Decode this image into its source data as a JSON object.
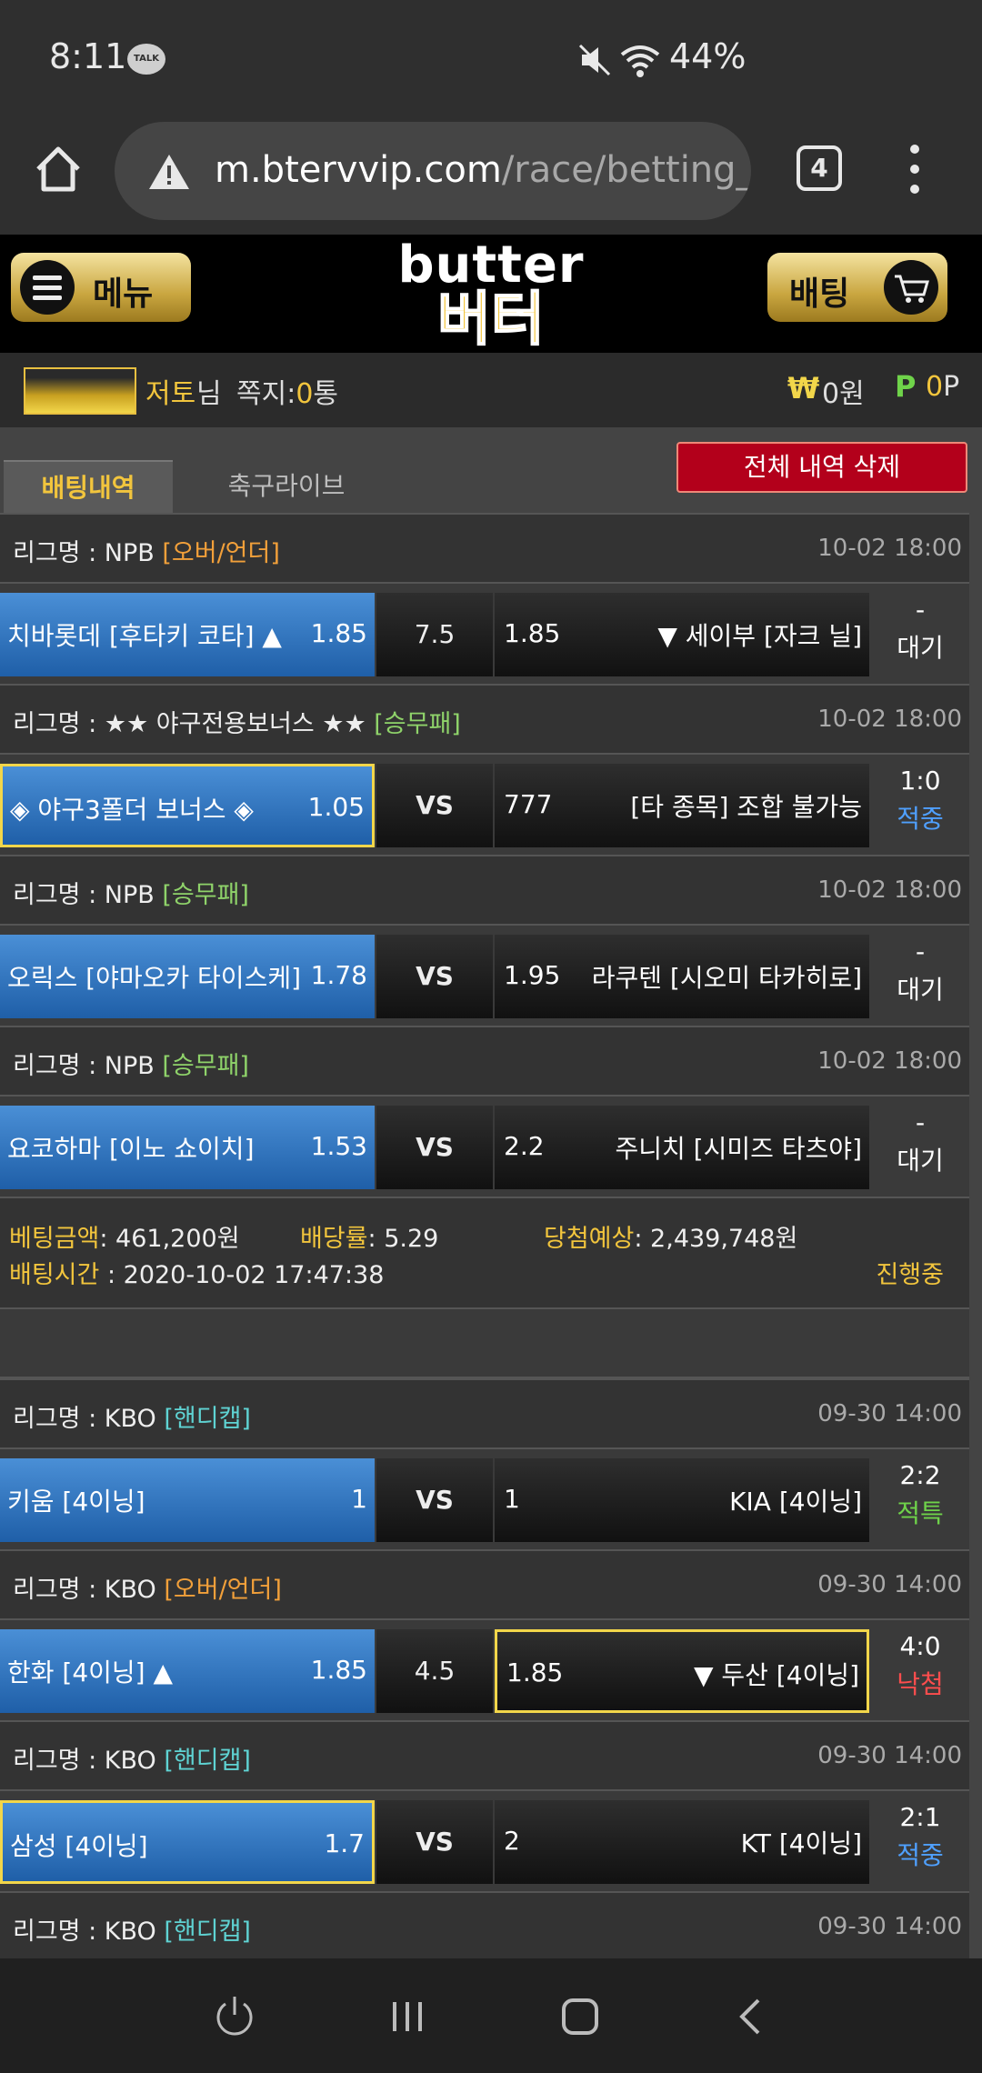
{
  "status": {
    "time": "8:11",
    "talk_badge": "TALK",
    "battery": "44%"
  },
  "browser": {
    "url_host": "m.btervvip.com",
    "url_path": "/race/betting_l",
    "tab_count": "4"
  },
  "header": {
    "menu_label": "메뉴",
    "bet_label": "배팅",
    "logo_en": "butter",
    "logo_ko": "버터"
  },
  "user": {
    "name": "저토",
    "suffix": "님",
    "msg_label": "쪽지:",
    "msg_count": "0",
    "msg_unit": "통",
    "won_symbol": "₩",
    "won_value": "0원",
    "point_symbol": "P",
    "point_value": "0",
    "point_unit": "P"
  },
  "tabs": {
    "active": "배팅내역",
    "inactive": "축구라이브",
    "delete_all": "전체 내역 삭제"
  },
  "bets": [
    {
      "league_prefix": "리그명 : NPB ",
      "league_tag": "[오버/언더]",
      "time": "10-02 18:00",
      "home": "치바롯데 [후타키 코타] ▲",
      "home_odds": "1.85",
      "mid": "7.5",
      "away_odds": "1.85",
      "away": "▼ 세이부 [자크 닐]",
      "score": "-",
      "state": "대기"
    },
    {
      "league_prefix": "리그명 : ★★ 야구전용보너스 ★★ ",
      "league_tag": "[승무패]",
      "time": "10-02 18:00",
      "home": "◈ 야구3폴더 보너스 ◈",
      "home_odds": "1.05",
      "mid": "VS",
      "away_odds": "777",
      "away": "[타 종목] 조합 불가능",
      "score": "1:0",
      "state": "적중"
    },
    {
      "league_prefix": "리그명 : NPB ",
      "league_tag": "[승무패]",
      "time": "10-02 18:00",
      "home": "오릭스 [야마오카 타이스케]",
      "home_odds": "1.78",
      "mid": "VS",
      "away_odds": "1.95",
      "away": "라쿠텐 [시오미 타카히로]",
      "score": "-",
      "state": "대기"
    },
    {
      "league_prefix": "리그명 : NPB ",
      "league_tag": "[승무패]",
      "time": "10-02 18:00",
      "home": "요코하마 [이노 쇼이치]",
      "home_odds": "1.53",
      "mid": "VS",
      "away_odds": "2.2",
      "away": "주니치 [시미즈 타츠야]",
      "score": "-",
      "state": "대기"
    },
    {
      "league_prefix": "리그명 : KBO ",
      "league_tag": "[핸디캡]",
      "time": "09-30 14:00",
      "home": "키움 [4이닝]",
      "home_odds": "1",
      "mid": "VS",
      "away_odds": "1",
      "away": "KIA [4이닝]",
      "score": "2:2",
      "state": "적특"
    },
    {
      "league_prefix": "리그명 : KBO ",
      "league_tag": "[오버/언더]",
      "time": "09-30 14:00",
      "home": "한화 [4이닝] ▲",
      "home_odds": "1.85",
      "mid": "4.5",
      "away_odds": "1.85",
      "away": "▼ 두산 [4이닝]",
      "score": "4:0",
      "state": "낙첨"
    },
    {
      "league_prefix": "리그명 : KBO ",
      "league_tag": "[핸디캡]",
      "time": "09-30 14:00",
      "home": "삼성 [4이닝]",
      "home_odds": "1.7",
      "mid": "VS",
      "away_odds": "2",
      "away": "KT [4이닝]",
      "score": "2:1",
      "state": "적중"
    },
    {
      "league_prefix": "리그명 : KBO ",
      "league_tag": "[핸디캡]",
      "time": "09-30 14:00"
    }
  ],
  "summary": {
    "amount_label": "베팅금액",
    "amount_value": ": 461,200원",
    "odds_label": "배당률",
    "odds_value": ": 5.29",
    "expect_label": "당첨예상",
    "expect_value": ": 2,439,748원",
    "time_label": "배팅시간",
    "time_value": " : 2020-10-02 17:47:38",
    "status": "진행중"
  },
  "colors": {
    "accent_gold": "#f2c53d",
    "home_blue": "#2f75c4",
    "delete_red": "#b3001b",
    "hit_blue": "#4fa0ff",
    "miss_red": "#ff4d4d",
    "tie_green": "#6fd34a"
  }
}
